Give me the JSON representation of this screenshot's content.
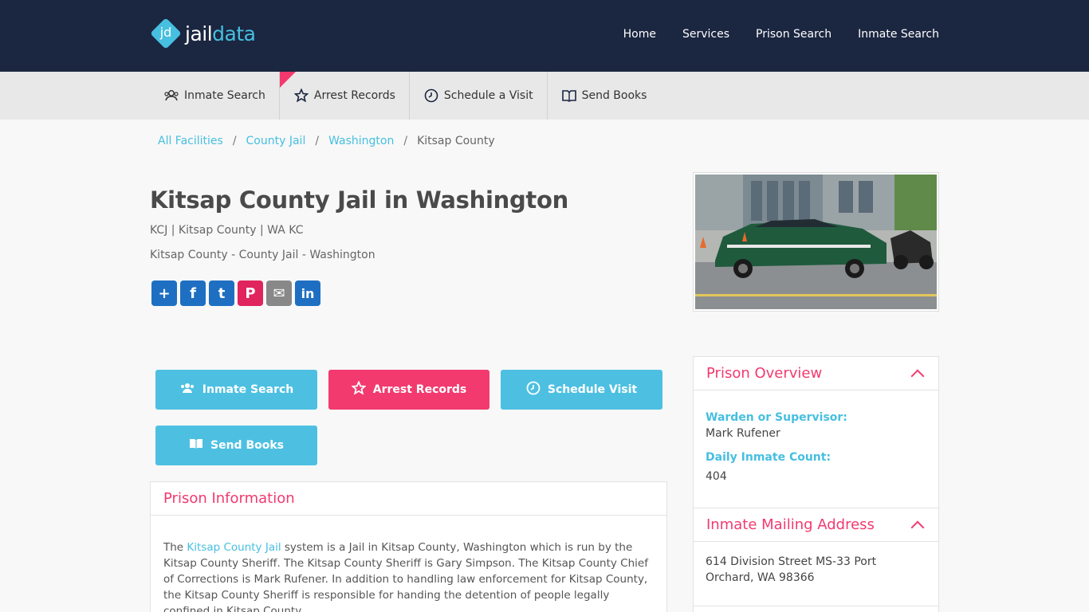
{
  "header": {
    "logo_mark": "jd",
    "logo_text_a": "jail",
    "logo_text_b": "data",
    "nav": [
      "Home",
      "Services",
      "Prison Search",
      "Inmate Search"
    ]
  },
  "subnav": [
    {
      "label": "Inmate Search",
      "icon": "users-icon"
    },
    {
      "label": "Arrest Records",
      "icon": "star-icon"
    },
    {
      "label": "Schedule a Visit",
      "icon": "clock-icon"
    },
    {
      "label": "Send Books",
      "icon": "book-icon"
    }
  ],
  "breadcrumb": [
    "All Facilities",
    "County Jail",
    "Washington",
    "Kitsap County"
  ],
  "page": {
    "title": "Kitsap County Jail in Washington",
    "subtitle1": "KCJ | Kitsap County | WA KC",
    "subtitle2": "Kitsap County - County Jail - Washington"
  },
  "share": [
    {
      "name": "share-icon",
      "glyph": "+",
      "color": "#1e6fc2"
    },
    {
      "name": "facebook-icon",
      "glyph": "f",
      "color": "#1e6fc2"
    },
    {
      "name": "twitter-icon",
      "glyph": "t",
      "color": "#1e6fc2"
    },
    {
      "name": "pinterest-icon",
      "glyph": "P",
      "color": "#e0245e"
    },
    {
      "name": "email-icon",
      "glyph": "✉",
      "color": "#888888"
    },
    {
      "name": "linkedin-icon",
      "glyph": "in",
      "color": "#1e6fc2"
    }
  ],
  "actions": {
    "inmate_search": "Inmate Search",
    "arrest_records": "Arrest Records",
    "schedule_visit": "Schedule Visit",
    "send_books": "Send Books"
  },
  "prison_info": {
    "title": "Prison Information",
    "text_pre": "The ",
    "link": "Kitsap County Jail",
    "text_post": " system is a Jail in Kitsap County, Washington which is run by the Kitsap County Sheriff.  The Kitsap County Sheriff is Gary Simpson.  The Kitsap County Chief of Corrections is Mark Rufener. In addition to handling law enforcement for Kitsap County, the Kitsap County Sheriff is responsible for handing the detention of people legally confined in Kitsap County."
  },
  "overview": {
    "title": "Prison Overview",
    "warden_label": "Warden or Supervisor:",
    "warden_value": "Mark Rufener",
    "count_label": "Daily Inmate Count:",
    "count_value": "404"
  },
  "mailing": {
    "title": "Inmate Mailing Address",
    "line1": "614 Division Street MS-33 Port",
    "line2": "Orchard, WA 98366"
  },
  "colors": {
    "header_bg": "#1b2640",
    "accent_blue": "#4dc0e2",
    "accent_pink": "#f23a6e"
  }
}
